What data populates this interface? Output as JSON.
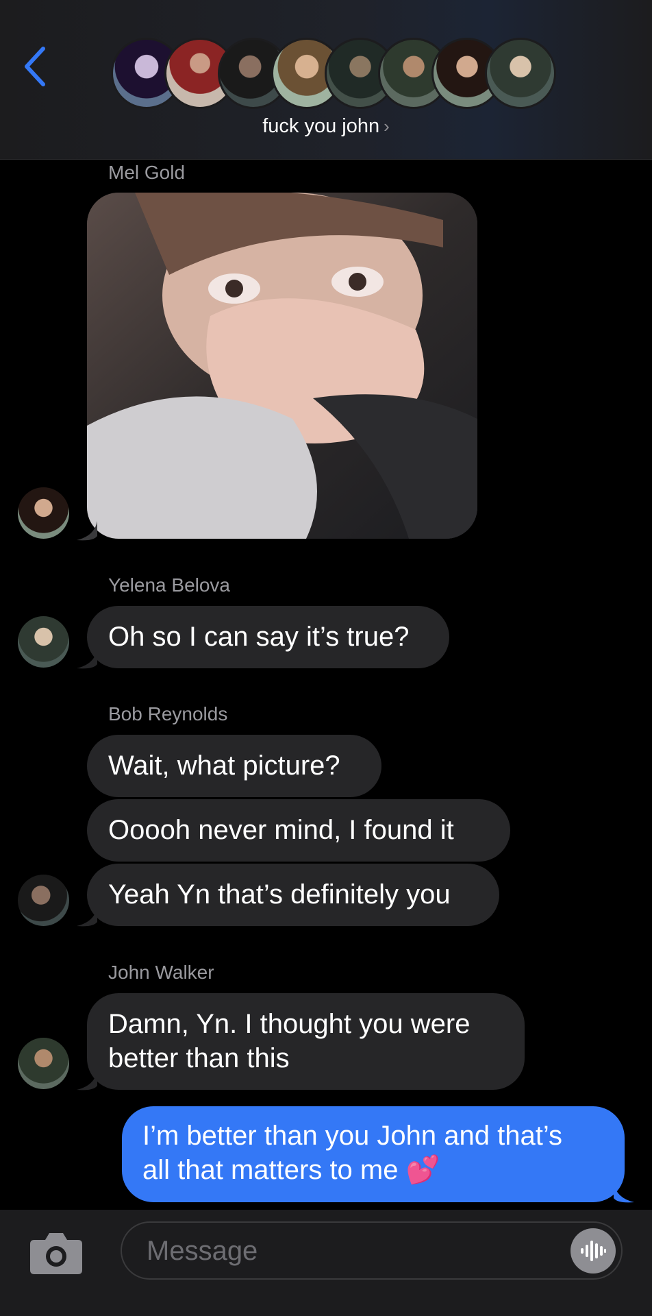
{
  "header": {
    "group_name": "fuck you john",
    "chevron": "›",
    "avatars": [
      "avatar-1",
      "avatar-2",
      "avatar-3",
      "avatar-4",
      "avatar-5",
      "avatar-6",
      "avatar-7",
      "avatar-8"
    ]
  },
  "messages": [
    {
      "sender": "Mel Gold",
      "type": "image",
      "content": "reaction-photo"
    },
    {
      "sender": "Yelena Belova",
      "text": "Oh so I can say it’s true?"
    },
    {
      "sender": "Bob Reynolds",
      "texts": [
        "Wait, what picture?",
        "Ooooh never mind, I found it",
        "Yeah Yn that’s definitely you"
      ]
    },
    {
      "sender": "John Walker",
      "lines": [
        "Damn, Yn. I thought you were",
        "better than this"
      ]
    },
    {
      "sender": "me",
      "lines": [
        "I’m better than you John and that’s",
        "all that matters to me"
      ],
      "emoji": "💕"
    }
  ],
  "composer": {
    "placeholder": "Message"
  },
  "colors": {
    "accent": "#3478f6",
    "incoming_bubble": "#262628",
    "sender_text": "#9a9a9f",
    "background": "#000000"
  }
}
